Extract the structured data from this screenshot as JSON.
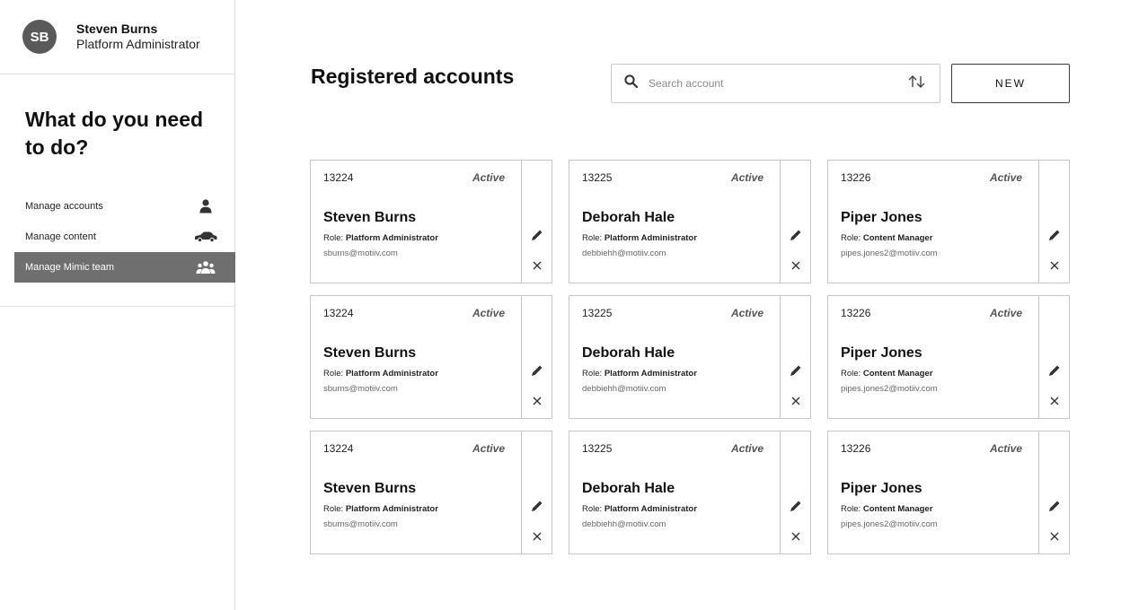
{
  "user": {
    "initials": "SB",
    "name": "Steven Burns",
    "role": "Platform Administrator"
  },
  "prompt": "What do you need to do?",
  "menu": [
    {
      "label": "Manage accounts",
      "icon": "person-icon",
      "active": false
    },
    {
      "label": "Manage content",
      "icon": "car-icon",
      "active": false
    },
    {
      "label": "Manage Mimic team",
      "icon": "group-icon",
      "active": true
    }
  ],
  "main": {
    "title": "Registered accounts",
    "search_placeholder": "Search account",
    "new_label": "NEW"
  },
  "accounts": [
    {
      "id": "13224",
      "status": "Active",
      "name": "Steven Burns",
      "role_prefix": "Role:",
      "role": "Platform Administrator",
      "email": "sburns@motiiv.com"
    },
    {
      "id": "13225",
      "status": "Active",
      "name": "Deborah Hale",
      "role_prefix": "Role:",
      "role": "Platform Administrator",
      "email": "debbiehh@motiiv.com"
    },
    {
      "id": "13226",
      "status": "Active",
      "name": "Piper Jones",
      "role_prefix": "Role:",
      "role": "Content Manager",
      "email": "pipes.jones2@motiiv.com"
    },
    {
      "id": "13224",
      "status": "Active",
      "name": "Steven Burns",
      "role_prefix": "Role:",
      "role": "Platform Administrator",
      "email": "sburns@motiiv.com"
    },
    {
      "id": "13225",
      "status": "Active",
      "name": "Deborah Hale",
      "role_prefix": "Role:",
      "role": "Platform Administrator",
      "email": "debbiehh@motiiv.com"
    },
    {
      "id": "13226",
      "status": "Active",
      "name": "Piper Jones",
      "role_prefix": "Role:",
      "role": "Content Manager",
      "email": "pipes.jones2@motiiv.com"
    },
    {
      "id": "13224",
      "status": "Active",
      "name": "Steven Burns",
      "role_prefix": "Role:",
      "role": "Platform Administrator",
      "email": "sburns@motiiv.com"
    },
    {
      "id": "13225",
      "status": "Active",
      "name": "Deborah Hale",
      "role_prefix": "Role:",
      "role": "Platform Administrator",
      "email": "debbiehh@motiiv.com"
    },
    {
      "id": "13226",
      "status": "Active",
      "name": "Piper Jones",
      "role_prefix": "Role:",
      "role": "Content Manager",
      "email": "pipes.jones2@motiiv.com"
    }
  ],
  "colors": {
    "active_menu_bg": "#6f6f6f",
    "avatar_bg": "#5a5a5a",
    "border": "#c6c6c6"
  }
}
